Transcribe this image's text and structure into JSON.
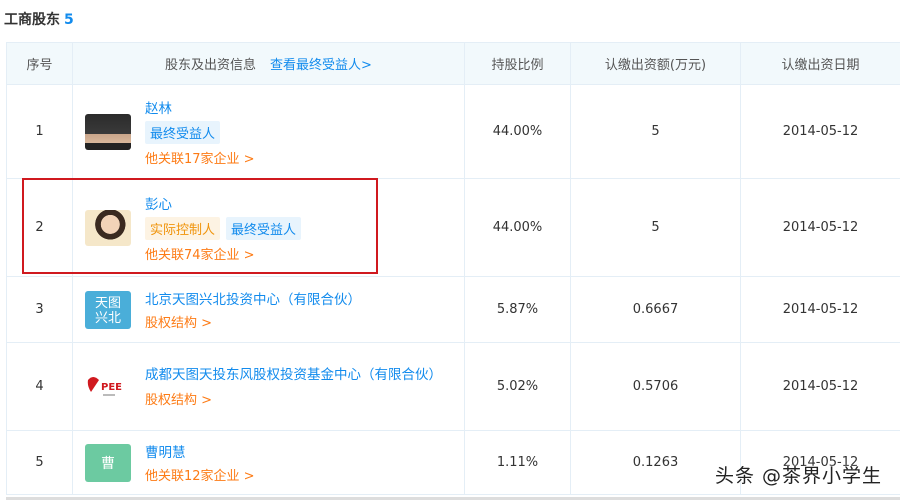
{
  "section": {
    "title": "工商股东",
    "count": "5"
  },
  "columns": {
    "seq": "序号",
    "holder": "股东及出资信息",
    "ubo_link": "查看最终受益人>",
    "ratio": "持股比例",
    "amount": "认缴出资额(万元)",
    "date": "认缴出资日期"
  },
  "rows": [
    {
      "seq": "1",
      "name": "赵林",
      "tags": [
        "最终受益人"
      ],
      "rel": "他关联17家企业 >",
      "ratio": "44.00%",
      "amount": "5",
      "date": "2014-05-12"
    },
    {
      "seq": "2",
      "name": "彭心",
      "tags": [
        "实际控制人",
        "最终受益人"
      ],
      "rel": "他关联74家企业 >",
      "ratio": "44.00%",
      "amount": "5",
      "date": "2014-05-12"
    },
    {
      "seq": "3",
      "avatar_text": "天图兴北",
      "avatar_line1": "天图",
      "avatar_line2": "兴北",
      "name": "北京天图兴北投资中心（有限合伙）",
      "rel": "股权结构 >",
      "ratio": "5.87%",
      "amount": "0.6667",
      "date": "2014-05-12"
    },
    {
      "seq": "4",
      "avatar_logo_text": "PEE",
      "name": "成都天图天投东风股权投资基金中心（有限合伙）",
      "rel": "股权结构 >",
      "ratio": "5.02%",
      "amount": "0.5706",
      "date": "2014-05-12"
    },
    {
      "seq": "5",
      "avatar_text": "曹",
      "name": "曹明慧",
      "rel": "他关联12家企业 >",
      "ratio": "1.11%",
      "amount": "0.1263",
      "date": "2014-05-12"
    }
  ],
  "watermark": "头条 @茶界小学生",
  "colors": {
    "link": "#128bed",
    "orange": "#fd7b15",
    "highlight": "#d0191f",
    "header_bg": "#f2f9fc"
  }
}
